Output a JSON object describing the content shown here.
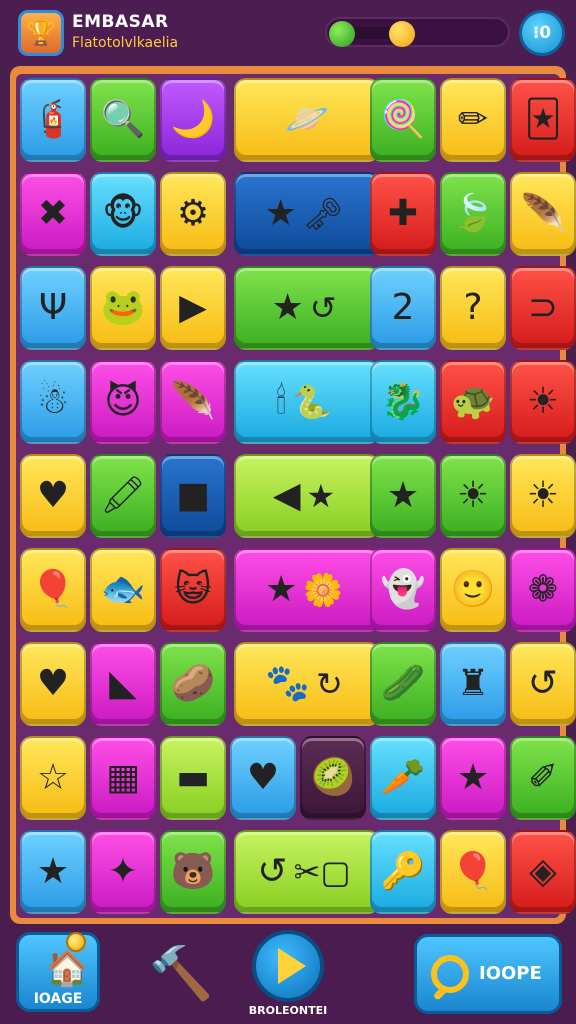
{
  "header": {
    "title": "EMBASAR",
    "subtitle": "Flatotolvlkaelia",
    "logo_icon": "🏆",
    "progress": 0.35,
    "menu_label": "⁝0"
  },
  "board": {
    "rows": [
      [
        {
          "c": "blue",
          "g": "🧯"
        },
        {
          "c": "green",
          "g": "🔍"
        },
        {
          "c": "purple",
          "g": "🌙"
        },
        {
          "c": "yellow",
          "g": "🪐",
          "w": 2
        },
        {
          "c": "green",
          "g": "🍭"
        },
        {
          "c": "yellow",
          "g": "✏"
        },
        {
          "c": "red",
          "g": "🃏"
        }
      ],
      [
        {
          "c": "magenta",
          "g": "✖"
        },
        {
          "c": "cyan",
          "g": "🐵"
        },
        {
          "c": "yellow",
          "g": "⚙"
        },
        {
          "c": "navy",
          "g": "★",
          "g2": "🗝",
          "w": 2
        },
        {
          "c": "red",
          "g": "✚"
        },
        {
          "c": "green",
          "g": "🍃"
        },
        {
          "c": "yellow",
          "g": "🪶"
        }
      ],
      [
        {
          "c": "blue",
          "g": "Ψ"
        },
        {
          "c": "yellow",
          "g": "🐸"
        },
        {
          "c": "yellow",
          "g": "▶"
        },
        {
          "c": "green",
          "g": "★",
          "g2": "↺",
          "w": 2
        },
        {
          "c": "blue",
          "g": "2"
        },
        {
          "c": "yellow",
          "g": "?"
        },
        {
          "c": "red",
          "g": "⊃"
        }
      ],
      [
        {
          "c": "blue",
          "g": "☃"
        },
        {
          "c": "magenta",
          "g": "😈"
        },
        {
          "c": "magenta",
          "g": "🪶"
        },
        {
          "c": "cyan",
          "g": "🕯",
          "g2": "🐍",
          "w": 2
        },
        {
          "c": "cyan",
          "g": "🐉"
        },
        {
          "c": "red",
          "g": "🐢"
        },
        {
          "c": "red",
          "g": "☀"
        }
      ],
      [
        {
          "c": "yellow",
          "g": "♥"
        },
        {
          "c": "green",
          "g": "🖍"
        },
        {
          "c": "navy",
          "g": "■"
        },
        {
          "c": "lime",
          "g": "◀",
          "g2": "★",
          "w": 2
        },
        {
          "c": "green",
          "g": "★"
        },
        {
          "c": "green",
          "g": "☀"
        },
        {
          "c": "yellow",
          "g": "☀"
        }
      ],
      [
        {
          "c": "yellow",
          "g": "🎈"
        },
        {
          "c": "yellow",
          "g": "🐟"
        },
        {
          "c": "red",
          "g": "😺"
        },
        {
          "c": "magenta",
          "g": "★",
          "g2": "🌼",
          "w": 2
        },
        {
          "c": "magenta",
          "g": "👻"
        },
        {
          "c": "yellow",
          "g": "🙂"
        },
        {
          "c": "magenta",
          "g": "❁"
        }
      ],
      [
        {
          "c": "yellow",
          "g": "♥"
        },
        {
          "c": "magenta",
          "g": "◣"
        },
        {
          "c": "green",
          "g": "🥔"
        },
        {
          "c": "yellow",
          "g": "🐾",
          "g2": "↻",
          "w": 2
        },
        {
          "c": "green",
          "g": "🥒"
        },
        {
          "c": "blue",
          "g": "♜"
        },
        {
          "c": "yellow",
          "g": "↺"
        }
      ],
      [
        {
          "c": "yellow",
          "g": "☆"
        },
        {
          "c": "magenta",
          "g": "▦"
        },
        {
          "c": "lime",
          "g": "▬"
        },
        {
          "c": "blue",
          "g": "♥"
        },
        {
          "c": "dark",
          "g": "🥝"
        },
        {
          "c": "cyan",
          "g": "🥕"
        },
        {
          "c": "magenta",
          "g": "★"
        },
        {
          "c": "green",
          "g": "✐"
        }
      ],
      [
        {
          "c": "blue",
          "g": "★"
        },
        {
          "c": "magenta",
          "g": "✦"
        },
        {
          "c": "green",
          "g": "🐻"
        },
        {
          "c": "lime",
          "g": "↺",
          "g2": "✂▢",
          "w": 2
        },
        {
          "c": "cyan",
          "g": "🔑"
        },
        {
          "c": "yellow",
          "g": "🎈"
        },
        {
          "c": "red",
          "g": "◈"
        }
      ]
    ]
  },
  "bottom": {
    "home_label": "IOAGE",
    "home_icon": "🏠",
    "hammer_icon": "🔨",
    "play_label": "BROLEONTEI",
    "search_label": "IOOPE"
  }
}
